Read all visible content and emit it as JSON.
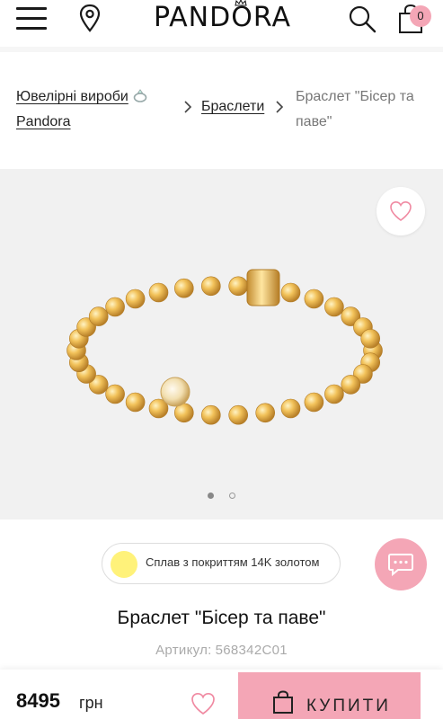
{
  "header": {
    "brand": "PANDORA",
    "menu_icon": "hamburger-menu-icon",
    "location_icon": "map-pin-icon",
    "search_icon": "search-icon",
    "cart_icon": "shopping-bag-icon",
    "cart_count": "0"
  },
  "breadcrumb": {
    "items": [
      {
        "label": "Ювелірні вироби",
        "sub": "Pandora",
        "icon": "ring-icon"
      },
      {
        "label": "Браслети"
      }
    ],
    "current": "Браслет \"Бісер та паве\""
  },
  "gallery": {
    "favorite_icon": "heart-outline-icon",
    "image_alt": "gold bead bracelet with pave charm",
    "slides_total": 2,
    "active_slide": 1
  },
  "material": {
    "swatch_color": "#fff27a",
    "label": "Сплав з покриттям 14K золотом"
  },
  "chat_icon": "chat-bubble-icon",
  "product": {
    "title": "Браслет \"Бісер та паве\"",
    "sku_label": "Артикул:",
    "sku": "568342C01"
  },
  "purchase": {
    "price": "8495",
    "currency": "грн",
    "buy_label": "КУПИТИ",
    "accent": "#f4a6b6"
  }
}
